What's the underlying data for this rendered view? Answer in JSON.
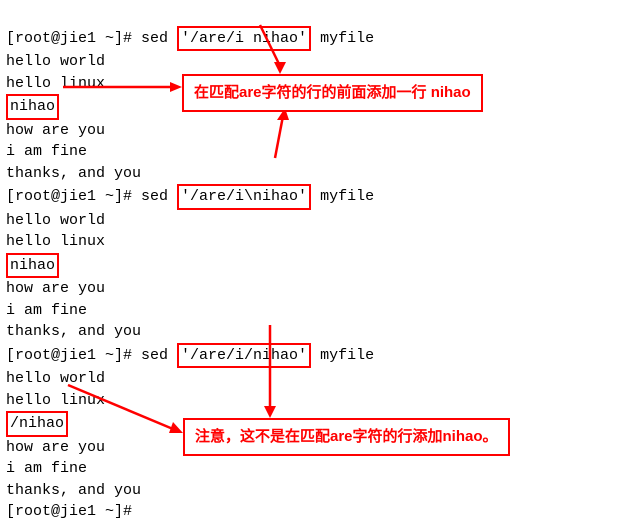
{
  "prompts": {
    "p1_prefix": "[root@jie1 ~]# sed ",
    "p1_cmd": "'/are/i nihao'",
    "p1_suffix": " myfile",
    "p2_prefix": "[root@jie1 ~]# sed ",
    "p2_cmd": "'/are/i\\nihao'",
    "p2_suffix": " myfile",
    "p3_prefix": "[root@jie1 ~]# sed ",
    "p3_cmd": "'/are/i/nihao'",
    "p3_suffix": " myfile",
    "p4": "[root@jie1 ~]# "
  },
  "output": {
    "l1": "hello world",
    "l2": "hello linux",
    "nihao": "nihao",
    "slashnihao": "/nihao",
    "l3": "how are you",
    "l4": "i am fine",
    "l5": "thanks, and you"
  },
  "callouts": {
    "c1": "在匹配are字符的行的前面添加一行 nihao",
    "c2": "注意，这不是在匹配are字符的行添加nihao。"
  }
}
